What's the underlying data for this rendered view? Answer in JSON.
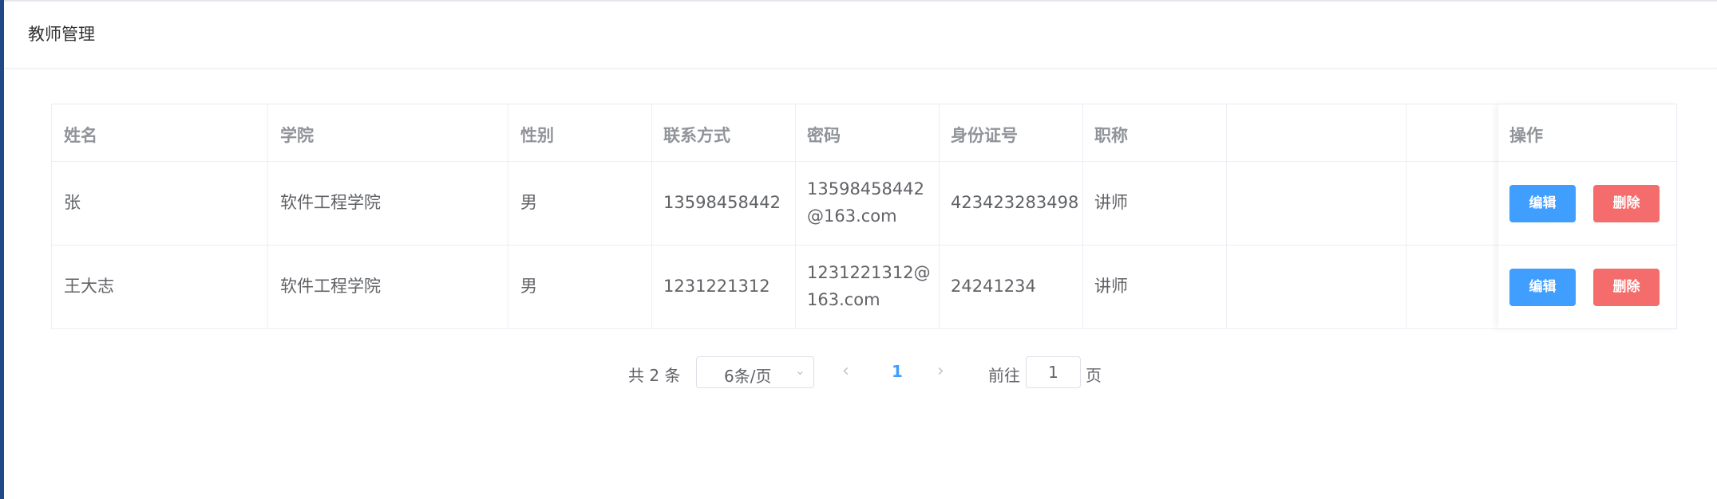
{
  "page": {
    "title": "教师管理"
  },
  "table": {
    "headers": {
      "name": "姓名",
      "college": "学院",
      "gender": "性别",
      "phone": "联系方式",
      "password": "密码",
      "id_number": "身份证号",
      "job_title": "职称",
      "extra": "",
      "actions": "操作"
    },
    "rows": [
      {
        "name": "张",
        "college": "软件工程学院",
        "gender": "男",
        "phone": "13598458442",
        "password_line1": "13598458442",
        "password_line2": "@163.com",
        "id_number": "423423283498",
        "job_title": "讲师",
        "edit_label": "编辑",
        "delete_label": "删除"
      },
      {
        "name": "王大志",
        "college": "软件工程学院",
        "gender": "男",
        "phone": "1231221312",
        "password_line1": "1231221312@",
        "password_line2": "163.com",
        "id_number": "24241234",
        "job_title": "讲师",
        "edit_label": "编辑",
        "delete_label": "删除"
      }
    ]
  },
  "pagination": {
    "total_text": "共 2 条",
    "page_size": "6条/页",
    "current_page": "1",
    "goto_label": "前往",
    "goto_value": "1",
    "goto_suffix": "页",
    "prev_icon": "chevron-left-icon",
    "next_icon": "chevron-right-icon",
    "dropdown_icon": "chevron-down-icon"
  },
  "colors": {
    "primary": "#409eff",
    "danger": "#f56c6c",
    "sidebar": "#1f4a86"
  }
}
